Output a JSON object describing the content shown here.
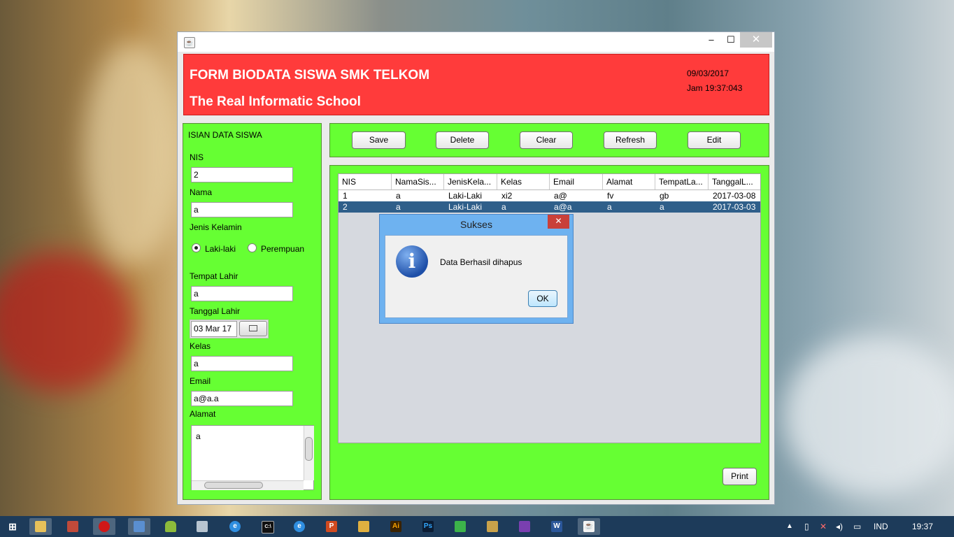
{
  "header": {
    "title": "FORM BIODATA SISWA SMK TELKOM",
    "subtitle": "The Real Informatic School",
    "date": "09/03/2017",
    "time": "Jam 19:37:043"
  },
  "window_controls": {
    "minimize": "–",
    "maximize": "☐",
    "close": "✕"
  },
  "form": {
    "section_title": "ISIAN DATA SISWA",
    "nis_label": "NIS",
    "nis_value": "2",
    "nama_label": "Nama",
    "nama_value": "a",
    "gender_label": "Jenis Kelamin",
    "gender_options": [
      "Laki-laki",
      "Perempuan"
    ],
    "gender_selected": "Laki-laki",
    "tempat_label": "Tempat Lahir",
    "tempat_value": "a",
    "tanggal_label": "Tanggal Lahir",
    "tanggal_value": "03 Mar 17",
    "kelas_label": "Kelas",
    "kelas_value": "a",
    "email_label": "Email",
    "email_value": "a@a.a",
    "alamat_label": "Alamat",
    "alamat_value": "a"
  },
  "toolbar": {
    "save": "Save",
    "delete": "Delete",
    "clear": "Clear",
    "refresh": "Refresh",
    "edit": "Edit"
  },
  "table": {
    "columns": [
      "NIS",
      "NamaSis...",
      "JenisKela...",
      "Kelas",
      "Email",
      "Alamat",
      "TempatLa...",
      "TanggalL..."
    ],
    "rows": [
      [
        "1",
        "a",
        "Laki-Laki",
        "xi2",
        "a@",
        "fv",
        "gb",
        "2017-03-08"
      ],
      [
        "2",
        "a",
        "Laki-Laki",
        "a",
        "a@a",
        "a",
        "a",
        "2017-03-03"
      ]
    ],
    "selected_row": 1
  },
  "print_button": "Print",
  "dialog": {
    "title": "Sukses",
    "close": "✕",
    "message": "Data Berhasil dihapus",
    "ok": "OK"
  },
  "taskbar": {
    "language": "IND",
    "clock": "19:37"
  },
  "colors": {
    "header_red": "#ff3b3b",
    "panel_green": "#66ff33",
    "selected_row": "#2f5f8a",
    "dialog_frame": "#6eb2f0"
  }
}
